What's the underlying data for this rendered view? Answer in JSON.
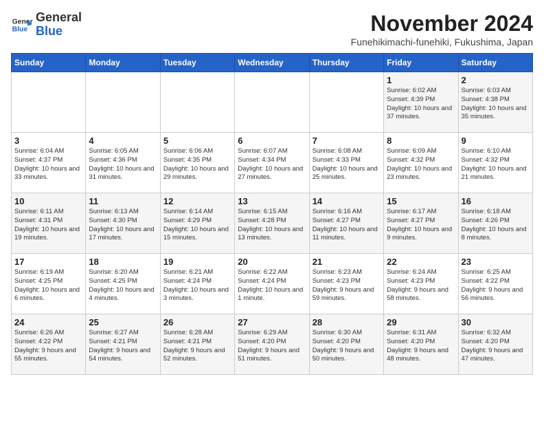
{
  "logo": {
    "general": "General",
    "blue": "Blue"
  },
  "title": "November 2024",
  "location": "Funehikimachi-funehiki, Fukushima, Japan",
  "days_of_week": [
    "Sunday",
    "Monday",
    "Tuesday",
    "Wednesday",
    "Thursday",
    "Friday",
    "Saturday"
  ],
  "weeks": [
    [
      {
        "day": "",
        "info": ""
      },
      {
        "day": "",
        "info": ""
      },
      {
        "day": "",
        "info": ""
      },
      {
        "day": "",
        "info": ""
      },
      {
        "day": "",
        "info": ""
      },
      {
        "day": "1",
        "info": "Sunrise: 6:02 AM\nSunset: 4:39 PM\nDaylight: 10 hours and 37 minutes."
      },
      {
        "day": "2",
        "info": "Sunrise: 6:03 AM\nSunset: 4:38 PM\nDaylight: 10 hours and 35 minutes."
      }
    ],
    [
      {
        "day": "3",
        "info": "Sunrise: 6:04 AM\nSunset: 4:37 PM\nDaylight: 10 hours and 33 minutes."
      },
      {
        "day": "4",
        "info": "Sunrise: 6:05 AM\nSunset: 4:36 PM\nDaylight: 10 hours and 31 minutes."
      },
      {
        "day": "5",
        "info": "Sunrise: 6:06 AM\nSunset: 4:35 PM\nDaylight: 10 hours and 29 minutes."
      },
      {
        "day": "6",
        "info": "Sunrise: 6:07 AM\nSunset: 4:34 PM\nDaylight: 10 hours and 27 minutes."
      },
      {
        "day": "7",
        "info": "Sunrise: 6:08 AM\nSunset: 4:33 PM\nDaylight: 10 hours and 25 minutes."
      },
      {
        "day": "8",
        "info": "Sunrise: 6:09 AM\nSunset: 4:32 PM\nDaylight: 10 hours and 23 minutes."
      },
      {
        "day": "9",
        "info": "Sunrise: 6:10 AM\nSunset: 4:32 PM\nDaylight: 10 hours and 21 minutes."
      }
    ],
    [
      {
        "day": "10",
        "info": "Sunrise: 6:11 AM\nSunset: 4:31 PM\nDaylight: 10 hours and 19 minutes."
      },
      {
        "day": "11",
        "info": "Sunrise: 6:13 AM\nSunset: 4:30 PM\nDaylight: 10 hours and 17 minutes."
      },
      {
        "day": "12",
        "info": "Sunrise: 6:14 AM\nSunset: 4:29 PM\nDaylight: 10 hours and 15 minutes."
      },
      {
        "day": "13",
        "info": "Sunrise: 6:15 AM\nSunset: 4:28 PM\nDaylight: 10 hours and 13 minutes."
      },
      {
        "day": "14",
        "info": "Sunrise: 6:16 AM\nSunset: 4:27 PM\nDaylight: 10 hours and 11 minutes."
      },
      {
        "day": "15",
        "info": "Sunrise: 6:17 AM\nSunset: 4:27 PM\nDaylight: 10 hours and 9 minutes."
      },
      {
        "day": "16",
        "info": "Sunrise: 6:18 AM\nSunset: 4:26 PM\nDaylight: 10 hours and 8 minutes."
      }
    ],
    [
      {
        "day": "17",
        "info": "Sunrise: 6:19 AM\nSunset: 4:25 PM\nDaylight: 10 hours and 6 minutes."
      },
      {
        "day": "18",
        "info": "Sunrise: 6:20 AM\nSunset: 4:25 PM\nDaylight: 10 hours and 4 minutes."
      },
      {
        "day": "19",
        "info": "Sunrise: 6:21 AM\nSunset: 4:24 PM\nDaylight: 10 hours and 3 minutes."
      },
      {
        "day": "20",
        "info": "Sunrise: 6:22 AM\nSunset: 4:24 PM\nDaylight: 10 hours and 1 minute."
      },
      {
        "day": "21",
        "info": "Sunrise: 6:23 AM\nSunset: 4:23 PM\nDaylight: 9 hours and 59 minutes."
      },
      {
        "day": "22",
        "info": "Sunrise: 6:24 AM\nSunset: 4:23 PM\nDaylight: 9 hours and 58 minutes."
      },
      {
        "day": "23",
        "info": "Sunrise: 6:25 AM\nSunset: 4:22 PM\nDaylight: 9 hours and 56 minutes."
      }
    ],
    [
      {
        "day": "24",
        "info": "Sunrise: 6:26 AM\nSunset: 4:22 PM\nDaylight: 9 hours and 55 minutes."
      },
      {
        "day": "25",
        "info": "Sunrise: 6:27 AM\nSunset: 4:21 PM\nDaylight: 9 hours and 54 minutes."
      },
      {
        "day": "26",
        "info": "Sunrise: 6:28 AM\nSunset: 4:21 PM\nDaylight: 9 hours and 52 minutes."
      },
      {
        "day": "27",
        "info": "Sunrise: 6:29 AM\nSunset: 4:20 PM\nDaylight: 9 hours and 51 minutes."
      },
      {
        "day": "28",
        "info": "Sunrise: 6:30 AM\nSunset: 4:20 PM\nDaylight: 9 hours and 50 minutes."
      },
      {
        "day": "29",
        "info": "Sunrise: 6:31 AM\nSunset: 4:20 PM\nDaylight: 9 hours and 48 minutes."
      },
      {
        "day": "30",
        "info": "Sunrise: 6:32 AM\nSunset: 4:20 PM\nDaylight: 9 hours and 47 minutes."
      }
    ]
  ]
}
